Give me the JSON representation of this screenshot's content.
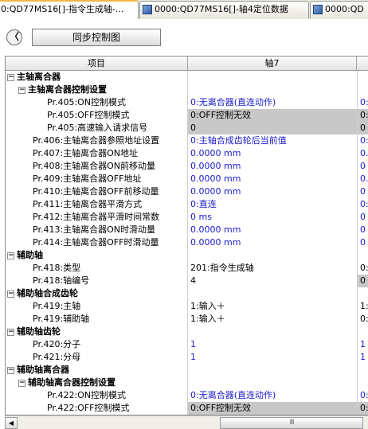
{
  "tabs": [
    {
      "label": "0:QD77MS16[]-指令生成轴-...",
      "active": true
    },
    {
      "label": "0000:QD77MS16[]-轴4定位数据",
      "active": false
    },
    {
      "label": "0000:QD",
      "active": false
    }
  ],
  "toolbar": {
    "back_glyph": "〈",
    "sync_label": "同步控制图"
  },
  "grid": {
    "headers": {
      "item": "项目",
      "axis": "轴7"
    },
    "rows": [
      {
        "indent": 1,
        "toggle": "−",
        "label": "主轴离合器",
        "bold": true,
        "v1": "",
        "v2": "",
        "v1_style": "",
        "v2_style": ""
      },
      {
        "indent": 2,
        "toggle": "−",
        "label": "主轴离合器控制设置",
        "bold": true,
        "v1": "",
        "v2": "",
        "v1_style": "",
        "v2_style": ""
      },
      {
        "indent": 3,
        "toggle": "",
        "label": "Pr.405:ON控制模式",
        "bold": false,
        "v1": "0:无离合器(直连动作)",
        "v2": "0:",
        "v1_style": "blue",
        "v2_style": "blue"
      },
      {
        "indent": 3,
        "toggle": "",
        "label": "Pr.405:OFF控制模式",
        "bold": false,
        "v1": "0:OFF控制无效",
        "v2": "0:",
        "v1_style": "grey",
        "v2_style": "grey"
      },
      {
        "indent": 3,
        "toggle": "",
        "label": "Pr.405:高速输入请求信号",
        "bold": false,
        "v1": "0",
        "v2": "0",
        "v1_style": "grey",
        "v2_style": "grey"
      },
      {
        "indent": 2,
        "toggle": "",
        "label": "Pr.406:主轴离合器参照地址设置",
        "bold": false,
        "v1": "0:主轴合成齿轮后当前值",
        "v2": "0:",
        "v1_style": "blue",
        "v2_style": "blue"
      },
      {
        "indent": 2,
        "toggle": "",
        "label": "Pr.407:主轴离合器ON地址",
        "bold": false,
        "v1": "0.0000 mm",
        "v2": "0.",
        "v1_style": "blue",
        "v2_style": "blue"
      },
      {
        "indent": 2,
        "toggle": "",
        "label": "Pr.408:主轴离合器ON前移动量",
        "bold": false,
        "v1": "0.0000 mm",
        "v2": "0 p",
        "v1_style": "blue",
        "v2_style": "blue"
      },
      {
        "indent": 2,
        "toggle": "",
        "label": "Pr.409:主轴离合器OFF地址",
        "bold": false,
        "v1": "0.0000 mm",
        "v2": "0.",
        "v1_style": "blue",
        "v2_style": "blue"
      },
      {
        "indent": 2,
        "toggle": "",
        "label": "Pr.410:主轴离合器OFF前移动量",
        "bold": false,
        "v1": "0.0000 mm",
        "v2": "0 p",
        "v1_style": "blue",
        "v2_style": "blue"
      },
      {
        "indent": 2,
        "toggle": "",
        "label": "Pr.411:主轴离合器平滑方式",
        "bold": false,
        "v1": "0:直连",
        "v2": "0:",
        "v1_style": "blue",
        "v2_style": "blue"
      },
      {
        "indent": 2,
        "toggle": "",
        "label": "Pr.412:主轴离合器平滑时间常数",
        "bold": false,
        "v1": "0 ms",
        "v2": "0 n",
        "v1_style": "blue",
        "v2_style": "blue"
      },
      {
        "indent": 2,
        "toggle": "",
        "label": "Pr.413:主轴离合器ON时滑动量",
        "bold": false,
        "v1": "0.0000 mm",
        "v2": "0 p",
        "v1_style": "blue",
        "v2_style": "blue"
      },
      {
        "indent": 2,
        "toggle": "",
        "label": "Pr.414:主轴离合器OFF时滑动量",
        "bold": false,
        "v1": "0.0000 mm",
        "v2": "0 p",
        "v1_style": "blue",
        "v2_style": "blue"
      },
      {
        "indent": 1,
        "toggle": "−",
        "label": "辅助轴",
        "bold": true,
        "v1": "",
        "v2": "",
        "v1_style": "",
        "v2_style": ""
      },
      {
        "indent": 2,
        "toggle": "",
        "label": "Pr.418:类型",
        "bold": false,
        "v1": "201:指令生成轴",
        "v2": "0:",
        "v1_style": "",
        "v2_style": ""
      },
      {
        "indent": 2,
        "toggle": "",
        "label": "Pr.418:轴编号",
        "bold": false,
        "v1": "4",
        "v2": "0",
        "v1_style": "",
        "v2_style": "grey"
      },
      {
        "indent": 1,
        "toggle": "−",
        "label": "辅助轴合成齿轮",
        "bold": true,
        "v1": "",
        "v2": "",
        "v1_style": "",
        "v2_style": ""
      },
      {
        "indent": 2,
        "toggle": "",
        "label": "Pr.419:主轴",
        "bold": false,
        "v1": "1:输入＋",
        "v2": "1:",
        "v1_style": "",
        "v2_style": ""
      },
      {
        "indent": 2,
        "toggle": "",
        "label": "Pr.419:辅助轴",
        "bold": false,
        "v1": "1:输入＋",
        "v2": "0:",
        "v1_style": "",
        "v2_style": ""
      },
      {
        "indent": 1,
        "toggle": "−",
        "label": "辅助轴齿轮",
        "bold": true,
        "v1": "",
        "v2": "",
        "v1_style": "",
        "v2_style": ""
      },
      {
        "indent": 2,
        "toggle": "",
        "label": "Pr.420:分子",
        "bold": false,
        "v1": "1",
        "v2": "1",
        "v1_style": "blue",
        "v2_style": "blue"
      },
      {
        "indent": 2,
        "toggle": "",
        "label": "Pr.421:分母",
        "bold": false,
        "v1": "1",
        "v2": "1",
        "v1_style": "blue",
        "v2_style": "blue"
      },
      {
        "indent": 1,
        "toggle": "−",
        "label": "辅助轴离合器",
        "bold": true,
        "v1": "",
        "v2": "",
        "v1_style": "",
        "v2_style": ""
      },
      {
        "indent": 2,
        "toggle": "−",
        "label": "辅助轴离合器控制设置",
        "bold": true,
        "v1": "",
        "v2": "",
        "v1_style": "",
        "v2_style": ""
      },
      {
        "indent": 3,
        "toggle": "",
        "label": "Pr.422:ON控制模式",
        "bold": false,
        "v1": "0:无离合器(直连动作)",
        "v2": "0:",
        "v1_style": "blue",
        "v2_style": "blue"
      },
      {
        "indent": 3,
        "toggle": "",
        "label": "Pr.422:OFF控制模式",
        "bold": false,
        "v1": "0:OFF控制无效",
        "v2": "0:",
        "v1_style": "grey",
        "v2_style": "grey"
      }
    ]
  },
  "scrollbar": {
    "left_glyph": "◀",
    "thumb_glyph": "III"
  }
}
